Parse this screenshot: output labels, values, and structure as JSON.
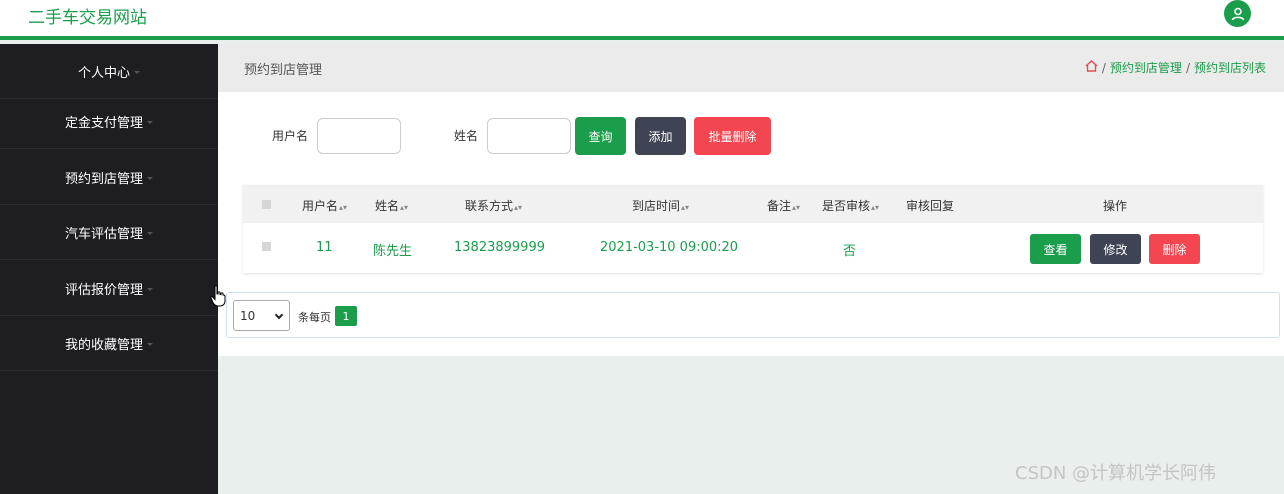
{
  "header": {
    "site_title": "二手车交易网站",
    "user_icon": "user-icon",
    "brand_color": "#1a9e4b"
  },
  "sidebar": {
    "items": [
      {
        "label": "个人中心"
      },
      {
        "label": "定金支付管理"
      },
      {
        "label": "预约到店管理"
      },
      {
        "label": "汽车评估管理"
      },
      {
        "label": "评估报价管理"
      },
      {
        "label": "我的收藏管理"
      }
    ]
  },
  "page": {
    "title": "预约到店管理",
    "breadcrumb": [
      "预约到店管理",
      "预约到店列表"
    ],
    "home_icon": "home-icon"
  },
  "search": {
    "username_label": "用户名",
    "username_value": "",
    "name_label": "姓名",
    "name_value": "",
    "query_label": "查询",
    "add_label": "添加",
    "batch_delete_label": "批量删除"
  },
  "table": {
    "headers": {
      "username": "用户名",
      "name": "姓名",
      "contact": "联系方式",
      "arrival_time": "到店时间",
      "remark": "备注",
      "approved": "是否审核",
      "review_reply": "审核回复",
      "actions": "操作"
    },
    "rows": [
      {
        "username": "11",
        "name": "陈先生",
        "contact": "13823899999",
        "arrival_time": "2021-03-10 09:00:20",
        "remark": "",
        "approved": "否",
        "review_reply": ""
      }
    ],
    "row_actions": {
      "view": "查看",
      "edit": "修改",
      "delete": "删除"
    }
  },
  "pagination": {
    "page_size": "10",
    "per_page_label": "条每页",
    "current_page": "1"
  },
  "colors": {
    "green": "#1a9e4b",
    "dark": "#3f4454",
    "red": "#f44650",
    "sidebar_bg": "#1e1e22"
  },
  "watermark": "CSDN @计算机学长阿伟"
}
